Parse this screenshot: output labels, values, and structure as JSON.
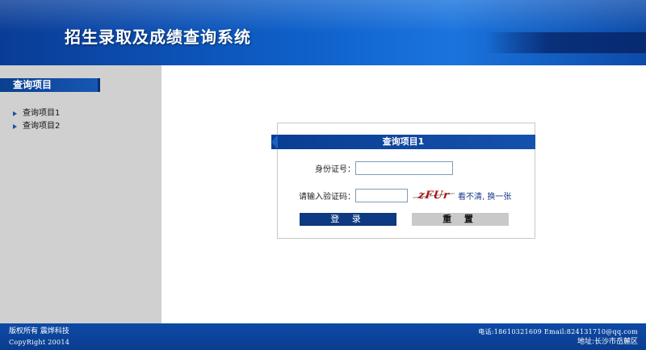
{
  "header": {
    "title": "招生录取及成绩查询系统"
  },
  "sidebar": {
    "heading": "查询项目",
    "items": [
      {
        "label": "查询项目1"
      },
      {
        "label": "查询项目2"
      }
    ]
  },
  "panel": {
    "title": "查询项目1",
    "id_label": "身份证号：",
    "id_value": "",
    "captcha_label": "请输入验证码：",
    "captcha_value": "",
    "captcha_text": "zFUr",
    "refresh_label": "看不清, 换一张",
    "login_label": "登 录",
    "reset_label": "重 置"
  },
  "footer": {
    "copyright_cn": "版权所有 震烨科技",
    "copyright_en": "CopyRight  20014",
    "contact": "电话:18610321609  Email:824131710@qq.com",
    "address": "地址:长沙市岳麓区"
  },
  "colors": {
    "header_blue": "#0e5fc8",
    "sidebar_gray": "#d0d0d0",
    "panel_head_blue": "#0a3d92",
    "login_button": "#0d3a80",
    "reset_button": "#c9c9c9",
    "footer_blue": "#0a3d8f",
    "captcha_red": "#b01010"
  }
}
